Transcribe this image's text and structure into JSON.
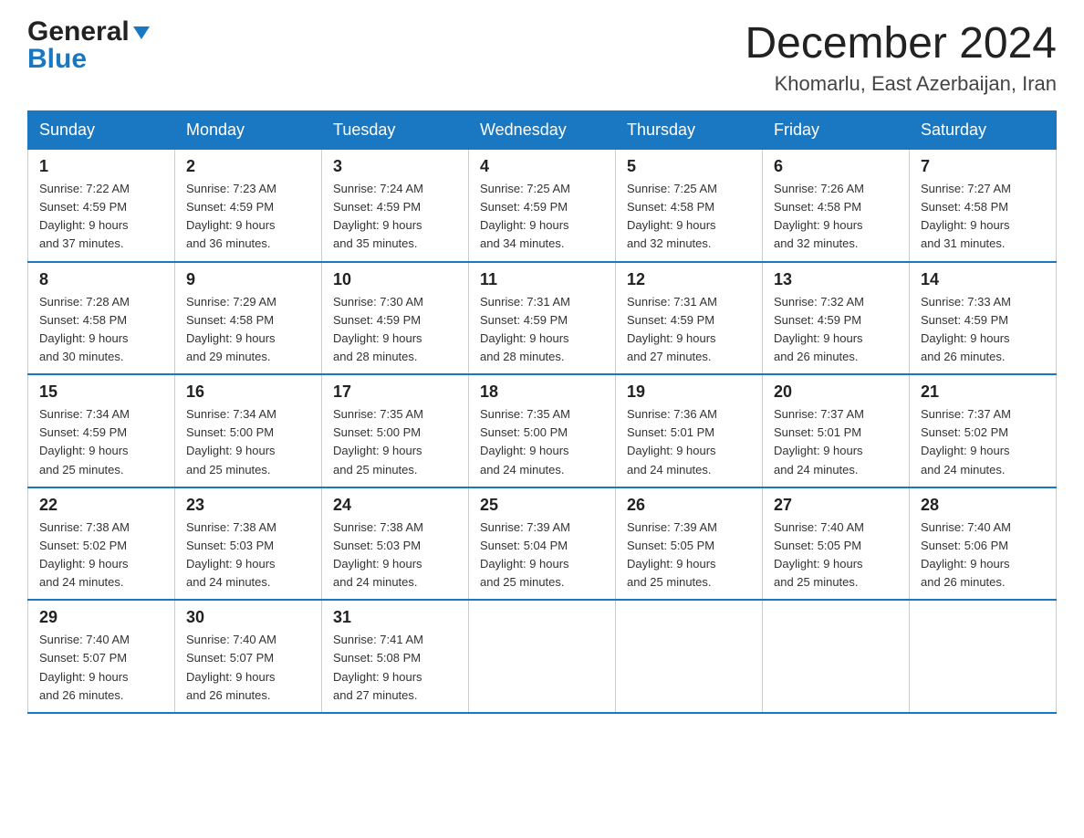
{
  "header": {
    "logo_general": "General",
    "logo_blue": "Blue",
    "month_title": "December 2024",
    "location": "Khomarlu, East Azerbaijan, Iran"
  },
  "days_of_week": [
    "Sunday",
    "Monday",
    "Tuesday",
    "Wednesday",
    "Thursday",
    "Friday",
    "Saturday"
  ],
  "weeks": [
    [
      {
        "day": "1",
        "sunrise": "7:22 AM",
        "sunset": "4:59 PM",
        "daylight": "9 hours and 37 minutes."
      },
      {
        "day": "2",
        "sunrise": "7:23 AM",
        "sunset": "4:59 PM",
        "daylight": "9 hours and 36 minutes."
      },
      {
        "day": "3",
        "sunrise": "7:24 AM",
        "sunset": "4:59 PM",
        "daylight": "9 hours and 35 minutes."
      },
      {
        "day": "4",
        "sunrise": "7:25 AM",
        "sunset": "4:59 PM",
        "daylight": "9 hours and 34 minutes."
      },
      {
        "day": "5",
        "sunrise": "7:25 AM",
        "sunset": "4:58 PM",
        "daylight": "9 hours and 32 minutes."
      },
      {
        "day": "6",
        "sunrise": "7:26 AM",
        "sunset": "4:58 PM",
        "daylight": "9 hours and 32 minutes."
      },
      {
        "day": "7",
        "sunrise": "7:27 AM",
        "sunset": "4:58 PM",
        "daylight": "9 hours and 31 minutes."
      }
    ],
    [
      {
        "day": "8",
        "sunrise": "7:28 AM",
        "sunset": "4:58 PM",
        "daylight": "9 hours and 30 minutes."
      },
      {
        "day": "9",
        "sunrise": "7:29 AM",
        "sunset": "4:58 PM",
        "daylight": "9 hours and 29 minutes."
      },
      {
        "day": "10",
        "sunrise": "7:30 AM",
        "sunset": "4:59 PM",
        "daylight": "9 hours and 28 minutes."
      },
      {
        "day": "11",
        "sunrise": "7:31 AM",
        "sunset": "4:59 PM",
        "daylight": "9 hours and 28 minutes."
      },
      {
        "day": "12",
        "sunrise": "7:31 AM",
        "sunset": "4:59 PM",
        "daylight": "9 hours and 27 minutes."
      },
      {
        "day": "13",
        "sunrise": "7:32 AM",
        "sunset": "4:59 PM",
        "daylight": "9 hours and 26 minutes."
      },
      {
        "day": "14",
        "sunrise": "7:33 AM",
        "sunset": "4:59 PM",
        "daylight": "9 hours and 26 minutes."
      }
    ],
    [
      {
        "day": "15",
        "sunrise": "7:34 AM",
        "sunset": "4:59 PM",
        "daylight": "9 hours and 25 minutes."
      },
      {
        "day": "16",
        "sunrise": "7:34 AM",
        "sunset": "5:00 PM",
        "daylight": "9 hours and 25 minutes."
      },
      {
        "day": "17",
        "sunrise": "7:35 AM",
        "sunset": "5:00 PM",
        "daylight": "9 hours and 25 minutes."
      },
      {
        "day": "18",
        "sunrise": "7:35 AM",
        "sunset": "5:00 PM",
        "daylight": "9 hours and 24 minutes."
      },
      {
        "day": "19",
        "sunrise": "7:36 AM",
        "sunset": "5:01 PM",
        "daylight": "9 hours and 24 minutes."
      },
      {
        "day": "20",
        "sunrise": "7:37 AM",
        "sunset": "5:01 PM",
        "daylight": "9 hours and 24 minutes."
      },
      {
        "day": "21",
        "sunrise": "7:37 AM",
        "sunset": "5:02 PM",
        "daylight": "9 hours and 24 minutes."
      }
    ],
    [
      {
        "day": "22",
        "sunrise": "7:38 AM",
        "sunset": "5:02 PM",
        "daylight": "9 hours and 24 minutes."
      },
      {
        "day": "23",
        "sunrise": "7:38 AM",
        "sunset": "5:03 PM",
        "daylight": "9 hours and 24 minutes."
      },
      {
        "day": "24",
        "sunrise": "7:38 AM",
        "sunset": "5:03 PM",
        "daylight": "9 hours and 24 minutes."
      },
      {
        "day": "25",
        "sunrise": "7:39 AM",
        "sunset": "5:04 PM",
        "daylight": "9 hours and 25 minutes."
      },
      {
        "day": "26",
        "sunrise": "7:39 AM",
        "sunset": "5:05 PM",
        "daylight": "9 hours and 25 minutes."
      },
      {
        "day": "27",
        "sunrise": "7:40 AM",
        "sunset": "5:05 PM",
        "daylight": "9 hours and 25 minutes."
      },
      {
        "day": "28",
        "sunrise": "7:40 AM",
        "sunset": "5:06 PM",
        "daylight": "9 hours and 26 minutes."
      }
    ],
    [
      {
        "day": "29",
        "sunrise": "7:40 AM",
        "sunset": "5:07 PM",
        "daylight": "9 hours and 26 minutes."
      },
      {
        "day": "30",
        "sunrise": "7:40 AM",
        "sunset": "5:07 PM",
        "daylight": "9 hours and 26 minutes."
      },
      {
        "day": "31",
        "sunrise": "7:41 AM",
        "sunset": "5:08 PM",
        "daylight": "9 hours and 27 minutes."
      },
      null,
      null,
      null,
      null
    ]
  ],
  "labels": {
    "sunrise": "Sunrise:",
    "sunset": "Sunset:",
    "daylight": "Daylight:"
  },
  "colors": {
    "header_bg": "#1a78c2",
    "header_text": "#ffffff",
    "border": "#ccc",
    "week_border": "#1a78c2"
  }
}
